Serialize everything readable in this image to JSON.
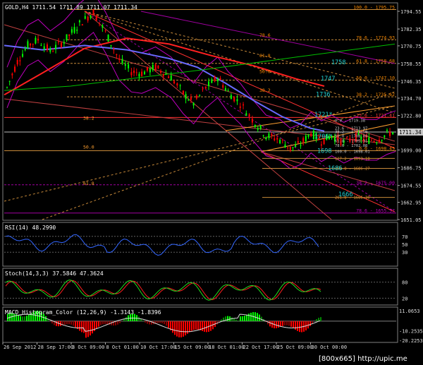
{
  "header": {
    "symbol_text": "GOLD,H4  1711.54 1711.89 1711.07 1711.34"
  },
  "price_axis": {
    "ticks": [
      "1794.55",
      "1782.35",
      "1770.75",
      "1758.55",
      "1746.35",
      "1734.70",
      "1722.80",
      "1711.34",
      "1699.00",
      "1686.75",
      "1674.55",
      "1662.95",
      "1651.05"
    ],
    "current": "1711.34"
  },
  "fib_labels": [
    {
      "text": "100.0 - 1795.75",
      "color": "#ff8c00"
    },
    {
      "text": "78.6 - 1774.93",
      "color": "#ff8c00"
    },
    {
      "text": "61.8 - 1758.68",
      "color": "#ff8c00"
    },
    {
      "text": "50.0 - 1747.10",
      "color": "#ff8c00"
    },
    {
      "text": "38.2 - 1735.62",
      "color": "#ff8c00"
    },
    {
      "text": "23.6 - 1721.41",
      "color": "#ff4040"
    },
    {
      "text": "0.0 - 1698.45",
      "color": "#ff8c00"
    },
    {
      "text": "38.2 - 1675.00",
      "color": "#c000c0"
    },
    {
      "text": "78.6 - 1655.57",
      "color": "#c000c0"
    }
  ],
  "fib_small_labels": [
    "0.0 - 1719.38",
    "23.6 - 1713.97",
    "38.2 - 1711.50",
    "50.0 - 1708.84",
    "61.8 - 1705.31",
    "78.6 - 1702.08",
    "100.0 - 1698.01",
    "127.2 - 1693.18",
    "161.8 - 1686.27",
    "261.8 - 1666.30"
  ],
  "level_marks": [
    "1758",
    "1747",
    "1736",
    "1721*",
    "1706*",
    "1698",
    "1686",
    "1666"
  ],
  "left_fib_texts": [
    "78.6",
    "61.8",
    "50.0",
    "38.2",
    "38.2",
    "50.0",
    "61.8"
  ],
  "rsi": {
    "title": "RSI(14) 48.2990",
    "levels": [
      "70",
      "50",
      "30"
    ]
  },
  "stoch": {
    "title": "Stoch(14,3,3) 37.5846 47.3624",
    "levels": [
      "80",
      "20"
    ]
  },
  "macd": {
    "title": "MACD_Histogram_Color (12,26,9)  -1.3143  -1.8396",
    "levels": [
      "11.0653",
      "-10.2535",
      "-20.2253"
    ]
  },
  "time_axis": [
    "26 Sep 2012",
    "28 Sep 17:00",
    "3 Oct 09:00",
    "8 Oct 01:00",
    "10 Oct 17:00",
    "15 Oct 09:00",
    "18 Oct 01:00",
    "22 Oct 17:00",
    "25 Oct 09:00",
    "30 Oct 00:00"
  ],
  "watermark": "[800x665] http://upic.me",
  "colors": {
    "bull": "#00ff00",
    "bear": "#ff0000",
    "ma_red": "#ff2020",
    "ma_blue": "#6a6aff",
    "ma_green": "#00c000",
    "bands": "#c000c0",
    "rsi": "#3366ff",
    "level_text": "#20d0d0"
  },
  "chart_data": {
    "type": "line",
    "title": "GOLD,H4",
    "ylim": [
      1651.05,
      1794.55
    ],
    "price_path": [
      [
        0,
        1742
      ],
      [
        6,
        1760
      ],
      [
        12,
        1771
      ],
      [
        18,
        1775
      ],
      [
        25,
        1767
      ],
      [
        33,
        1774
      ],
      [
        42,
        1786
      ],
      [
        50,
        1794
      ],
      [
        57,
        1780
      ],
      [
        65,
        1761
      ],
      [
        72,
        1753
      ],
      [
        78,
        1752
      ],
      [
        86,
        1756
      ],
      [
        95,
        1749
      ],
      [
        102,
        1738
      ],
      [
        108,
        1731
      ],
      [
        115,
        1742
      ],
      [
        122,
        1749
      ],
      [
        128,
        1739
      ],
      [
        135,
        1731
      ],
      [
        142,
        1720
      ],
      [
        150,
        1709
      ],
      [
        158,
        1706
      ],
      [
        164,
        1700
      ],
      [
        170,
        1703
      ],
      [
        176,
        1711
      ],
      [
        182,
        1705
      ],
      [
        188,
        1709
      ],
      [
        195,
        1704
      ],
      [
        202,
        1708
      ],
      [
        208,
        1706
      ],
      [
        214,
        1706
      ],
      [
        220,
        1710
      ],
      [
        225,
        1712
      ]
    ]
  }
}
